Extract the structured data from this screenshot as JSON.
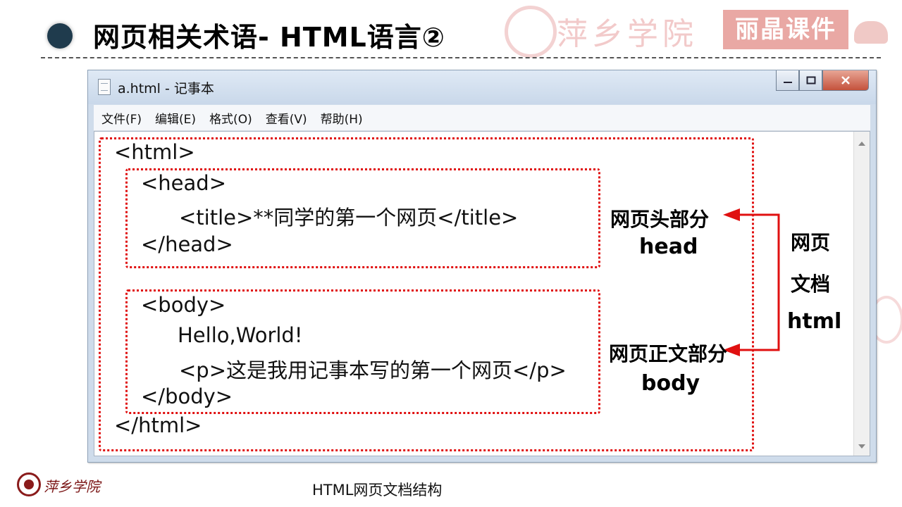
{
  "slide": {
    "title": "网页相关术语- HTML语言②",
    "caption": "HTML网页文档结构",
    "brand_badge": "丽晶课件",
    "school_name": "萍乡学院"
  },
  "window": {
    "title": "a.html - 记事本",
    "menu": [
      "文件(F)",
      "编辑(E)",
      "格式(O)",
      "查看(V)",
      "帮助(H)"
    ]
  },
  "code_lines": [
    "<html>",
    "<head>",
    "<title>**同学的第一个网页</title>",
    "</head>",
    "<body>",
    "Hello,World!",
    "<p>这是我用记事本写的第一个网页</p>",
    "</body>",
    "</html>"
  ],
  "annotations": {
    "head_label": "网页头部分",
    "head_tag": "head",
    "body_label": "网页正文部分",
    "body_tag": "body",
    "doc_label_1": "网页",
    "doc_label_2": "文档",
    "doc_tag": "html"
  },
  "colors": {
    "accent": "#e01010",
    "bullet": "#1f3b4d",
    "brand_badge": "#e9a8a4"
  }
}
